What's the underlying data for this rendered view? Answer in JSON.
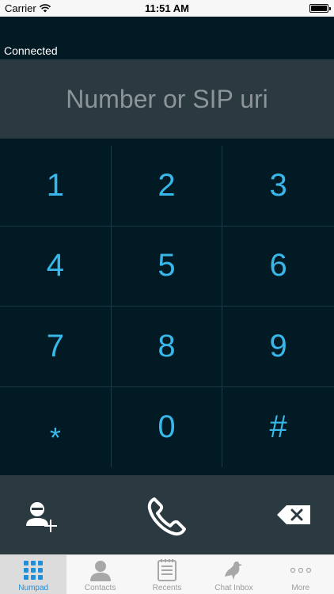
{
  "status_bar": {
    "carrier": "Carrier",
    "time": "11:51 AM"
  },
  "connection_status": "Connected",
  "number_field": {
    "placeholder": "Number or SIP uri",
    "value": ""
  },
  "keypad": {
    "keys": [
      {
        "label": "1"
      },
      {
        "label": "2"
      },
      {
        "label": "3"
      },
      {
        "label": "4"
      },
      {
        "label": "5"
      },
      {
        "label": "6"
      },
      {
        "label": "7"
      },
      {
        "label": "8"
      },
      {
        "label": "9"
      },
      {
        "label": "*"
      },
      {
        "label": "0"
      },
      {
        "label": "#"
      }
    ]
  },
  "actions": {
    "add_contact_icon": "add-contact-icon",
    "call_icon": "phone-icon",
    "backspace_icon": "backspace-icon"
  },
  "tabs": [
    {
      "label": "Numpad",
      "icon": "grid-icon",
      "active": true
    },
    {
      "label": "Contacts",
      "icon": "person-icon",
      "active": false
    },
    {
      "label": "Recents",
      "icon": "list-icon",
      "active": false
    },
    {
      "label": "Chat Inbox",
      "icon": "bird-icon",
      "active": false
    },
    {
      "label": "More",
      "icon": "ellipsis-icon",
      "active": false
    }
  ],
  "colors": {
    "accent": "#38b8ea",
    "background": "#021a24",
    "panel": "#2a3a40",
    "tab_active": "#1f8fdc"
  }
}
